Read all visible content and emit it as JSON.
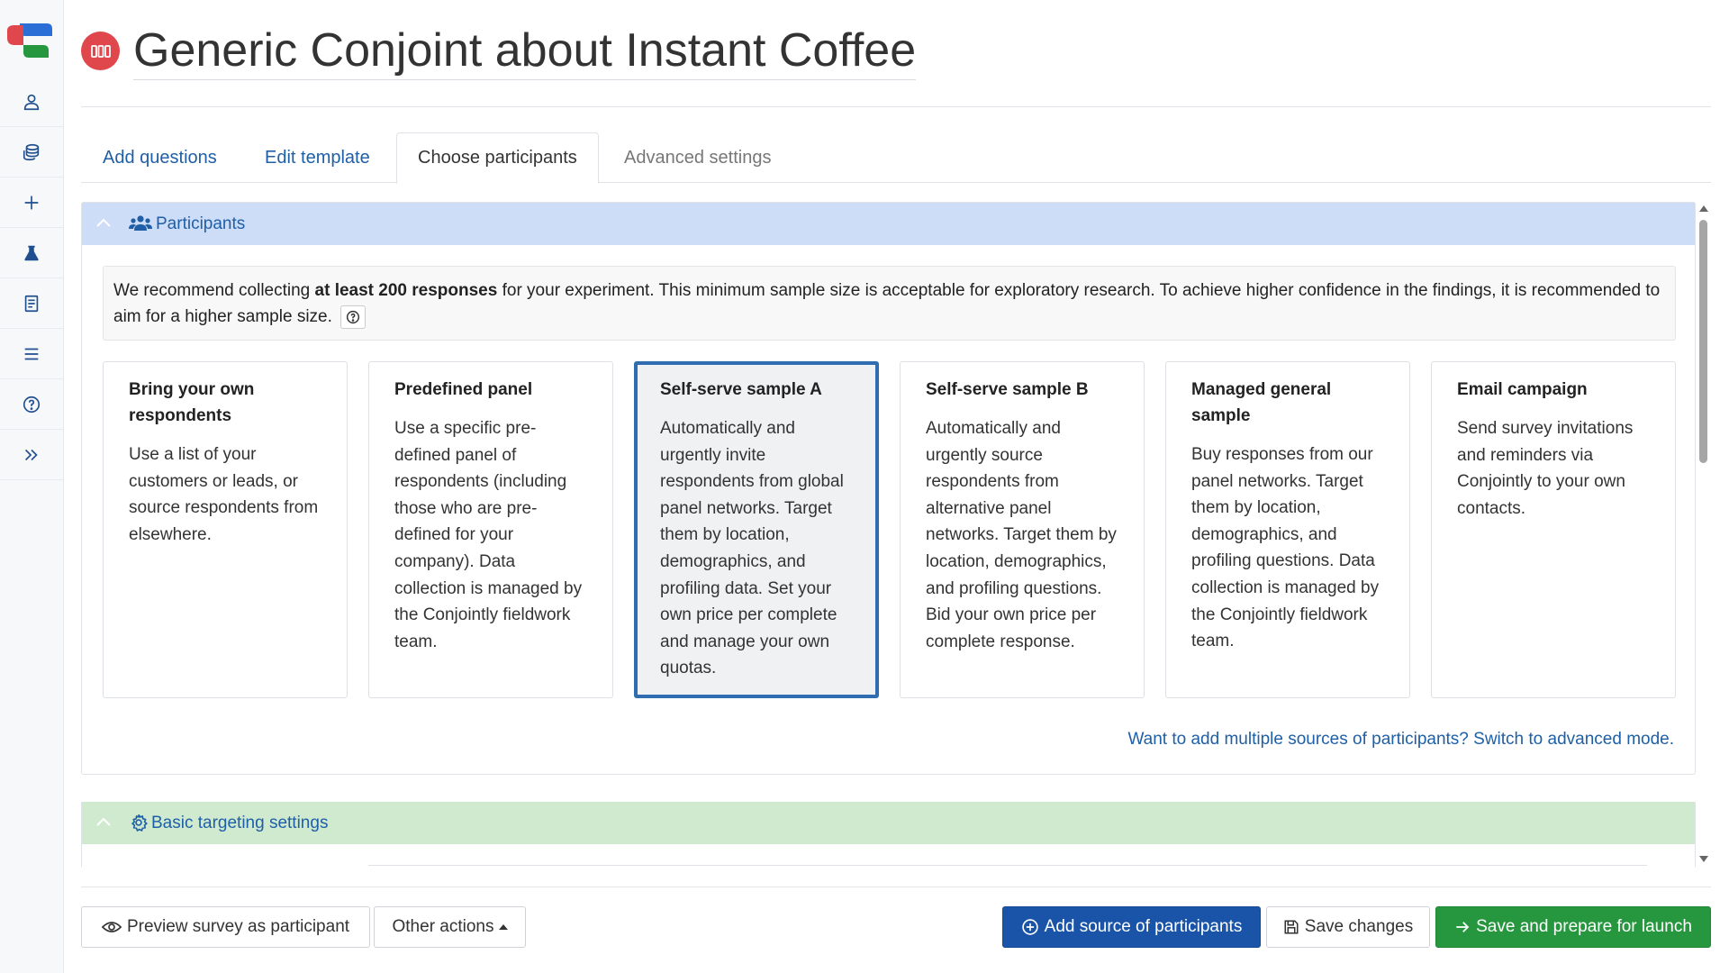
{
  "app": {
    "title": "Generic Conjoint about Instant Coffee",
    "brand_colors": {
      "red": "#e0474c",
      "blue": "#2b6fd6",
      "green": "#27973f"
    }
  },
  "sidebar": {
    "items": [
      {
        "icon": "user-icon",
        "name": "account"
      },
      {
        "icon": "database-icon",
        "name": "data"
      },
      {
        "icon": "plus-icon",
        "name": "new"
      },
      {
        "icon": "flask-icon",
        "name": "experiments"
      },
      {
        "icon": "book-icon",
        "name": "guides"
      },
      {
        "icon": "menu-icon",
        "name": "menu"
      },
      {
        "icon": "question-icon",
        "name": "help"
      },
      {
        "icon": "expand-icon",
        "name": "expand"
      }
    ]
  },
  "tabs": [
    {
      "label": "Add questions",
      "state": "link"
    },
    {
      "label": "Edit template",
      "state": "link"
    },
    {
      "label": "Choose participants",
      "state": "active"
    },
    {
      "label": "Advanced settings",
      "state": "muted"
    }
  ],
  "participants": {
    "heading": "Participants",
    "notice_before": "We recommend collecting ",
    "notice_bold": "at least 200 responses",
    "notice_after": " for your experiment. This minimum sample size is acceptable for exploratory research. To achieve higher confidence in the findings, it is recommended to aim for a higher sample size.",
    "options": [
      {
        "title": "Bring your own respondents",
        "description": "Use a list of your customers or leads, or source respondents from elsewhere.",
        "selected": false
      },
      {
        "title": "Predefined panel",
        "description": "Use a specific pre-defined panel of respondents (including those who are pre-defined for your company). Data collection is managed by the Conjointly fieldwork team.",
        "selected": false
      },
      {
        "title": "Self-serve sample A",
        "description": "Automatically and urgently invite respondents from global panel networks. Target them by location, demographics, and profiling data. Set your own price per complete and manage your own quotas.",
        "selected": true
      },
      {
        "title": "Self-serve sample B",
        "description": "Automatically and urgently source respondents from alternative panel networks. Target them by location, demographics, and profiling questions. Bid your own price per complete response.",
        "selected": false
      },
      {
        "title": "Managed general sample",
        "description": "Buy responses from our panel networks. Target them by location, demographics, and profiling questions. Data collection is managed by the Conjointly fieldwork team.",
        "selected": false
      },
      {
        "title": "Email campaign",
        "description": "Send survey invitations and reminders via Conjointly to your own contacts.",
        "selected": false
      }
    ],
    "advanced_link": "Want to add multiple sources of participants? Switch to advanced mode."
  },
  "targeting": {
    "heading": "Basic targeting settings"
  },
  "footer": {
    "preview_label": "Preview survey as participant",
    "other_actions_label": "Other actions",
    "add_source_label": "Add source of participants",
    "save_label": "Save changes",
    "launch_label": "Save and prepare for launch"
  }
}
